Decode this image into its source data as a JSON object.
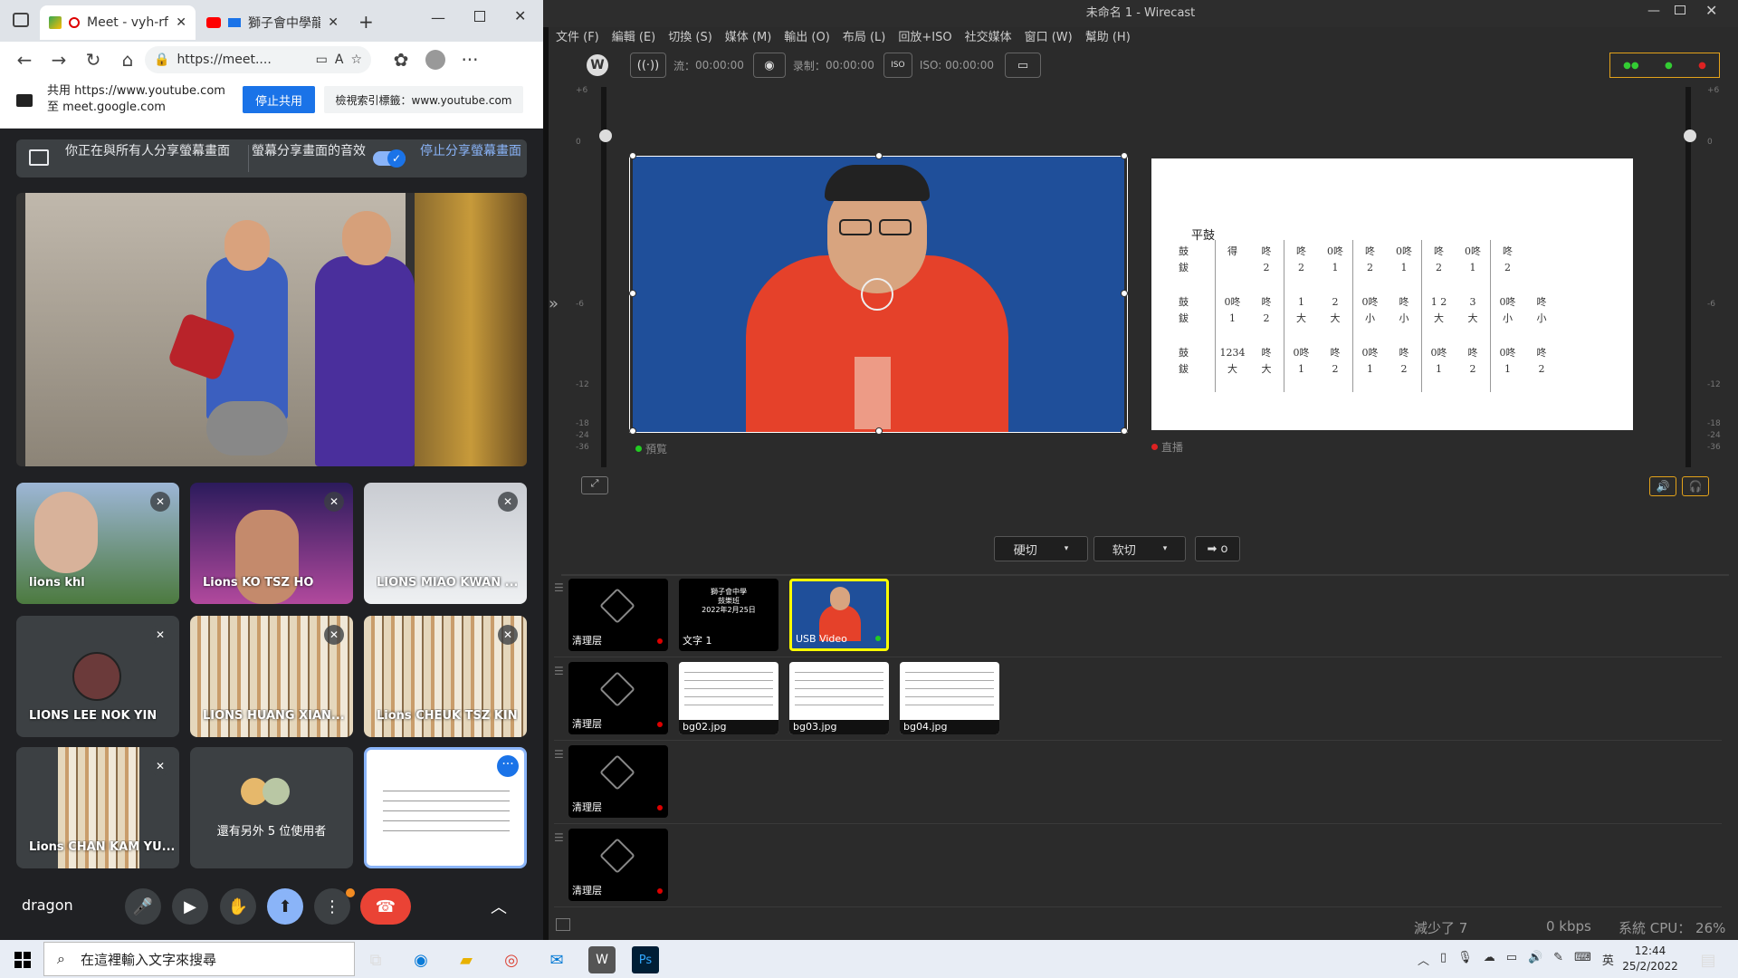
{
  "browser": {
    "tabs": [
      {
        "label": "Meet - vyh-rfd",
        "active": true
      },
      {
        "label": "獅子會中學龍"
      }
    ],
    "url": "https://meet....",
    "share_bar": {
      "line1": "共用 https://www.youtube.com",
      "line2": "至 meet.google.com",
      "stop_label": "停止共用",
      "switch_label": "檢視索引標籤：www.youtube.com"
    }
  },
  "meet": {
    "banner": {
      "presenting": "你正在與所有人分享螢幕畫面",
      "audio": "螢幕分享畫面的音效",
      "stop": "停止分享螢幕畫面"
    },
    "participants": [
      {
        "name": "lions khl"
      },
      {
        "name": "Lions KO TSZ HO"
      },
      {
        "name": "LIONS MIAO KWAN ..."
      },
      {
        "name": "LIONS LEE NOK YIN"
      },
      {
        "name": "LIONS HUANG XIAN..."
      },
      {
        "name": "Lions CHEUK TSZ KIN"
      },
      {
        "name": "Lions CHAN KAM YU..."
      }
    ],
    "others_label": "還有另外 5 位使用者",
    "self_name": "dragon"
  },
  "wirecast": {
    "title": "未命名 1 - Wirecast",
    "menu": [
      "文件 (F)",
      "編輯 (E)",
      "切換 (S)",
      "媒体 (M)",
      "輸出 (O)",
      "布局 (L)",
      "回放+ISO",
      "社交媒体",
      "窗口 (W)",
      "幫助 (H)"
    ],
    "stream_label": "流：",
    "stream_time": "00:00:00",
    "record_label": "录制：",
    "record_time": "00:00:00",
    "iso_label": "ISO: 00:00:00",
    "preview_label": "預覧",
    "live_label": "直播",
    "cut_label": "硬切",
    "smooth_label": "软切",
    "go_label": "➡ o",
    "vu_ticks": [
      "+6",
      "0",
      "-6",
      "-12",
      "-18",
      "-24",
      "-36"
    ],
    "score_title": "平鼓",
    "score_rows": [
      {
        "labels": [
          "鼓",
          "鈸"
        ],
        "cells": [
          [
            "得",
            ""
          ],
          [
            "咚",
            "2"
          ],
          [
            "咚",
            "2"
          ],
          [
            "0咚",
            "1"
          ],
          [
            "咚",
            "2"
          ],
          [
            "0咚",
            "1"
          ],
          [
            "咚",
            "2"
          ],
          [
            "0咚",
            "1"
          ],
          [
            "咚",
            "2"
          ]
        ]
      },
      {
        "labels": [
          "鼓",
          "鈸"
        ],
        "cells": [
          [
            "0咚",
            "1"
          ],
          [
            "咚",
            "2"
          ],
          [
            "1",
            "大"
          ],
          [
            "2",
            "大"
          ],
          [
            "0咚",
            "小"
          ],
          [
            "咚",
            "小"
          ],
          [
            "1 2",
            "大"
          ],
          [
            "3",
            "大"
          ],
          [
            "0咚",
            "小"
          ],
          [
            "咚",
            "小"
          ]
        ]
      },
      {
        "labels": [
          "鼓",
          "鈸"
        ],
        "cells": [
          [
            "1234",
            "大"
          ],
          [
            "咚",
            "大"
          ],
          [
            "0咚",
            "1"
          ],
          [
            "咚",
            "2"
          ],
          [
            "0咚",
            "1"
          ],
          [
            "咚",
            "2"
          ],
          [
            "0咚",
            "1"
          ],
          [
            "咚",
            "2"
          ],
          [
            "0咚",
            "1"
          ],
          [
            "咚",
            "2"
          ]
        ]
      }
    ],
    "layers": [
      {
        "name": "清理层",
        "shots": [
          {
            "label": "文字 1"
          },
          {
            "label": "USB Video"
          }
        ]
      },
      {
        "name": "清理层",
        "shots": [
          {
            "label": "bg02.jpg"
          },
          {
            "label": "bg03.jpg"
          },
          {
            "label": "bg04.jpg"
          }
        ]
      },
      {
        "name": "清理层",
        "shots": []
      },
      {
        "name": "清理层",
        "shots": []
      }
    ],
    "text_shot_lines": [
      "獅子會中學",
      "鼓樂班",
      "2022年2月25日"
    ],
    "status": {
      "reduced": "減少了 7",
      "kbps": "0 kbps",
      "cpu": "系統 CPU： 26%"
    }
  },
  "taskbar": {
    "search_placeholder": "在這裡輸入文字來搜尋",
    "time": "12:44",
    "date": "25/2/2022",
    "ime": "英"
  }
}
